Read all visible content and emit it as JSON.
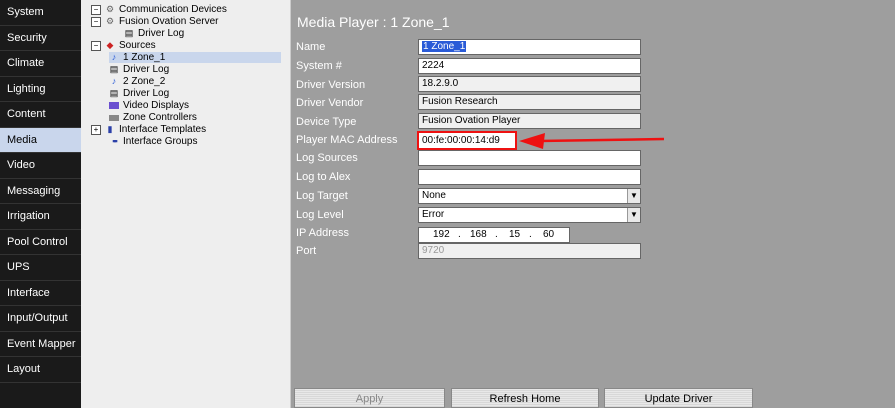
{
  "nav": {
    "items": [
      "System",
      "Security",
      "Climate",
      "Lighting",
      "Content",
      "Media",
      "Video",
      "Messaging",
      "Irrigation",
      "Pool Control",
      "UPS",
      "Interface",
      "Input/Output",
      "Event Mapper",
      "Layout"
    ],
    "active": "Media"
  },
  "tree": {
    "communication_devices": "Communication Devices",
    "fusion_ovation_server": "Fusion Ovation Server",
    "driver_log_1": "Driver Log",
    "sources": "Sources",
    "zone_1": "1 Zone_1",
    "driver_log_2": "Driver Log",
    "zone_2": "2 Zone_2",
    "driver_log_3": "Driver Log",
    "video_displays": "Video Displays",
    "zone_controllers": "Zone Controllers",
    "interface_templates": "Interface Templates",
    "interface_groups": "Interface Groups"
  },
  "main": {
    "title": "Media Player : 1 Zone_1",
    "labels": {
      "name": "Name",
      "system_num": "System #",
      "driver_version": "Driver Version",
      "driver_vendor": "Driver Vendor",
      "device_type": "Device Type",
      "mac": "Player MAC Address",
      "log_sources": "Log Sources",
      "log_to_alex": "Log to Alex",
      "log_target": "Log Target",
      "log_level": "Log Level",
      "ip": "IP Address",
      "port": "Port"
    },
    "values": {
      "name": "1 Zone_1",
      "system_num": "2224",
      "driver_version": "18.2.9.0",
      "driver_vendor": "Fusion Research",
      "device_type": "Fusion Ovation Player",
      "mac": "00:fe:00:00:14:d9",
      "log_sources": "",
      "log_to_alex": "",
      "log_target": "None",
      "log_level": "Error",
      "ip": [
        "192",
        "168",
        "15",
        "60"
      ],
      "port": "9720"
    },
    "buttons": {
      "apply": "Apply",
      "refresh_home": "Refresh Home",
      "update_driver": "Update Driver"
    }
  },
  "colors": {
    "nav_bg": "#1a1a1a",
    "nav_active_bg": "#c9d6ec",
    "main_bg": "#9e9e9e",
    "highlight_red": "#e11111",
    "selection_blue": "#2a5bd7"
  }
}
